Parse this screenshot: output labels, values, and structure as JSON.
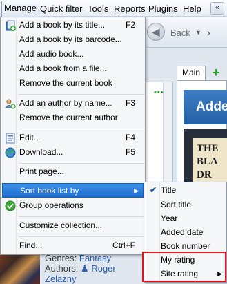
{
  "menubar": {
    "items": [
      "Manage",
      "Quick filter",
      "Tools",
      "Reports",
      "Plugins",
      "Help"
    ],
    "control_glyph": "«"
  },
  "background": {
    "back_label": "Back",
    "tab_main": "Main",
    "banner_text": "Addec",
    "cover_text": "THE\nBLA\nDR",
    "genres_label": "Genres:",
    "genres_value": "Fantasy",
    "authors_label": "Authors:",
    "authors_value_1": "Roger",
    "authors_value_2": "Zelazny"
  },
  "manage_menu": {
    "items": [
      {
        "label": "Add a book by its title...",
        "shortcut": "F2",
        "icon": "add-book-icon"
      },
      {
        "label": "Add a book by its barcode...",
        "shortcut": ""
      },
      {
        "label": "Add audio book...",
        "shortcut": ""
      },
      {
        "label": "Add a book from a file...",
        "shortcut": ""
      },
      {
        "label": "Remove the current book",
        "shortcut": ""
      },
      {
        "label": "Add an author by name...",
        "shortcut": "F3",
        "icon": "add-author-icon"
      },
      {
        "label": "Remove the current author",
        "shortcut": ""
      },
      {
        "label": "Edit...",
        "shortcut": "F4",
        "icon": "edit-icon"
      },
      {
        "label": "Download...",
        "shortcut": "F5",
        "icon": "globe-icon"
      },
      {
        "label": "Print page...",
        "shortcut": ""
      },
      {
        "label": "Sort book list by",
        "shortcut": ""
      },
      {
        "label": "Group operations",
        "shortcut": "",
        "icon": "check-circle-icon"
      },
      {
        "label": "Customize collection...",
        "shortcut": ""
      },
      {
        "label": "Find...",
        "shortcut": "Ctrl+F"
      }
    ]
  },
  "sort_submenu": {
    "items": [
      {
        "label": "Title",
        "checked": true
      },
      {
        "label": "Sort title"
      },
      {
        "label": "Year"
      },
      {
        "label": "Added date"
      },
      {
        "label": "Book number"
      },
      {
        "label": "My rating"
      },
      {
        "label": "Site rating",
        "has_submenu": true
      }
    ]
  },
  "colors": {
    "highlight": "#1e6fd0",
    "annotation_box": "#e0141e",
    "link": "#2a5fb0"
  }
}
